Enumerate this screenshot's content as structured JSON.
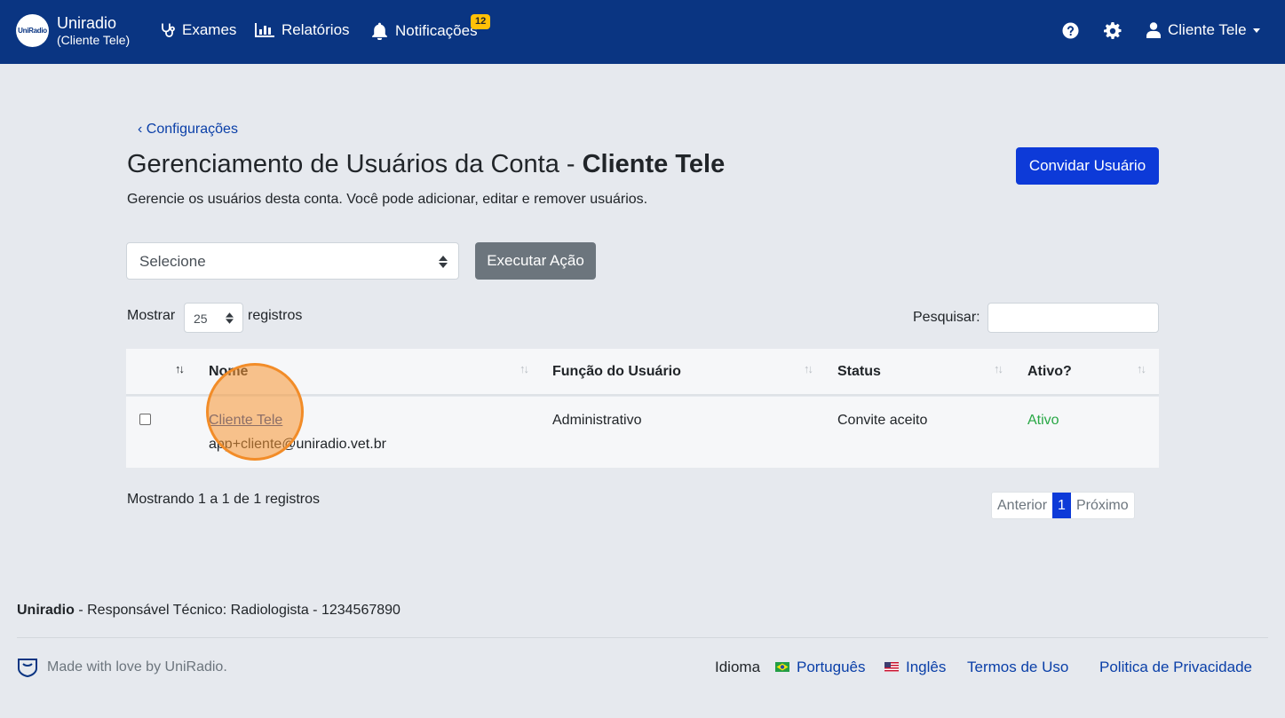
{
  "navbar": {
    "brand_logo_text": "UniRadio",
    "brand_name": "Uniradio",
    "brand_sub": "(Cliente Tele)",
    "items": [
      {
        "label": "Exames",
        "icon": "stethoscope-icon"
      },
      {
        "label": "Relatórios",
        "icon": "bar-chart-icon"
      },
      {
        "label": "Notificações",
        "icon": "bell-icon"
      }
    ],
    "notification_count": "12",
    "user_label": "Cliente Tele",
    "colors": {
      "navbar": "#0a3582",
      "badge": "#ffc107"
    }
  },
  "page": {
    "back_link": "Configurações",
    "title_prefix": "Gerenciamento de Usuários da Conta - ",
    "title_account": "Cliente Tele",
    "description": "Gerencie os usuários desta conta. Você pode adicionar, editar e remover usuários.",
    "invite_button": "Convidar Usuário",
    "action_select": "Selecione",
    "execute_button": "Executar Ação"
  },
  "table_controls": {
    "show_label": "Mostrar",
    "page_length": "25",
    "records_label": "registros",
    "search_label": "Pesquisar:",
    "search_value": ""
  },
  "table": {
    "columns": [
      "Nome",
      "Função do Usuário",
      "Status",
      "Ativo?"
    ],
    "rows": [
      {
        "name": "Cliente Tele",
        "email": "app+cliente@uniradio.vet.br",
        "role": "Administrativo",
        "status": "Convite aceito",
        "active": "Ativo"
      }
    ]
  },
  "pagination": {
    "info": "Mostrando 1 a 1 de 1 registros",
    "previous": "Anterior",
    "current": "1",
    "next": "Próximo"
  },
  "footer": {
    "brand": "Uniradio",
    "responsible": " - Responsável Técnico: Radiologista - 1234567890",
    "made_with": "Made with love by UniRadio.",
    "language_label": "Idioma",
    "lang_pt": "Português",
    "lang_en": "Inglês",
    "terms": "Termos de Uso",
    "privacy": "Politica de Privacidade"
  }
}
